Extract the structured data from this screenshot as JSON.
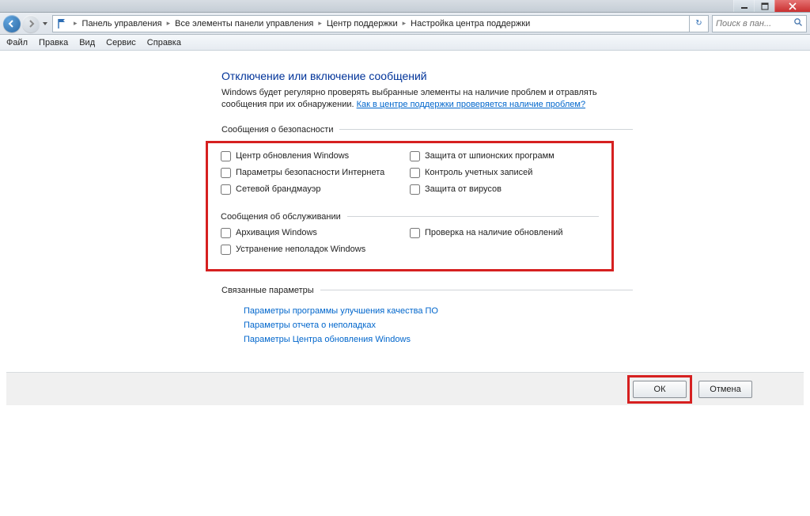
{
  "breadcrumb": {
    "item1": "Панель управления",
    "item2": "Все элементы панели управления",
    "item3": "Центр поддержки",
    "item4": "Настройка центра поддержки"
  },
  "search": {
    "placeholder": "Поиск в пан..."
  },
  "menu": {
    "file": "Файл",
    "edit": "Правка",
    "view": "Вид",
    "service": "Сервис",
    "help": "Справка"
  },
  "heading": "Отключение или включение сообщений",
  "desc1": "Windows будет регулярно проверять выбранные элементы на наличие проблем и отравлять сообщения при их обнаружении.",
  "desc_link": "Как в центре поддержки проверяется наличие проблем?",
  "section_security": "Сообщения о безопасности",
  "security": {
    "c1": "Центр обновления Windows",
    "c2": "Параметры безопасности Интернета",
    "c3": "Сетевой брандмауэр",
    "c4": "Защита от шпионских программ",
    "c5": "Контроль учетных записей",
    "c6": "Защита от вирусов"
  },
  "section_maintenance": "Сообщения об обслуживании",
  "maintenance": {
    "c1": "Архивация Windows",
    "c2": "Устранение неполадок Windows",
    "c3": "Проверка на наличие обновлений"
  },
  "section_related": "Связанные параметры",
  "related": {
    "l1": "Параметры программы улучшения качества ПО",
    "l2": "Параметры отчета о неполадках",
    "l3": "Параметры Центра обновления Windows"
  },
  "buttons": {
    "ok": "ОК",
    "cancel": "Отмена"
  }
}
